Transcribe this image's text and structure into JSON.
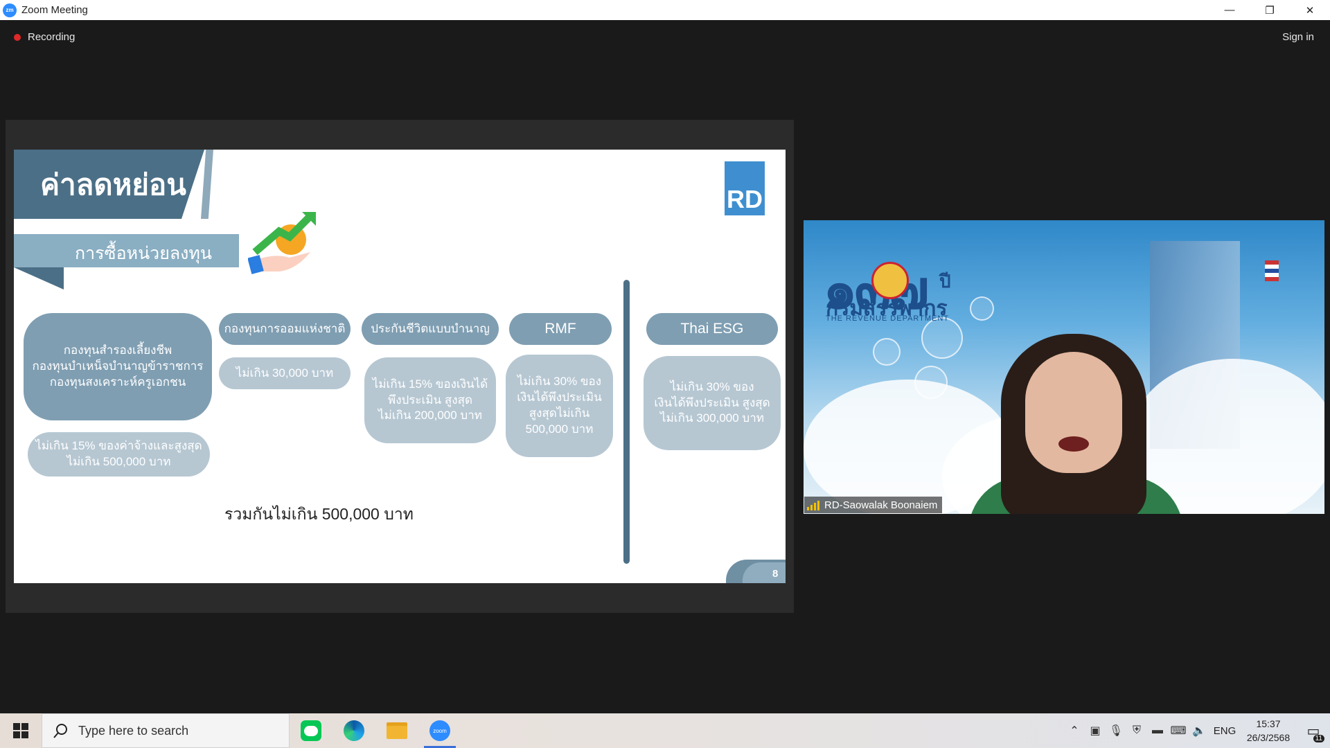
{
  "window": {
    "logo_text": "zm",
    "title": "Zoom Meeting",
    "minimize": "—",
    "restore": "❐",
    "close": "✕"
  },
  "meeting": {
    "recording_label": "Recording",
    "sign_in_label": "Sign in"
  },
  "slide": {
    "title": "ค่าลดหย่อน",
    "subtitle": "การซื้อหน่วยลงทุน",
    "logo_text": "RD",
    "col1_header": "กองทุนสำรองเลี้ยงชีพ\nกองทุนบำเหน็จบำนาญข้าราชการ\nกองทุนสงเคราะห์ครูเอกชน",
    "col1_value": "ไม่เกิน 15% ของค่าจ้างและสูงสุด\nไม่เกิน 500,000 บาท",
    "col2_header": "กองทุนการออมแห่งชาติ",
    "col2_value": "ไม่เกิน 30,000 บาท",
    "col3_header": "ประกันชีวิตแบบบำนาญ",
    "col3_value": "ไม่เกิน 15% ของเงินได้\nพึงประเมิน สูงสุด\nไม่เกิน 200,000 บาท",
    "col4_header": "RMF",
    "col4_value": "ไม่เกิน 30% ของ\nเงินได้พึงประเมิน\nสูงสุดไม่เกิน\n500,000 บาท",
    "col5_header": "Thai ESG",
    "col5_value": "ไม่เกิน 30% ของ\nเงินได้พึงประเมิน สูงสุด\nไม่เกิน 300,000 บาท",
    "total": "รวมกันไม่เกิน 500,000 บาท",
    "page_number": "8"
  },
  "video": {
    "logo_text": "๑๓๗",
    "logo_suffix": "ปี",
    "org_thai": "กรมสรรพากร",
    "org_english": "THE REVENUE DEPARTMENT",
    "participant_name": "RD-Saowalak Boonaiem"
  },
  "taskbar": {
    "search_placeholder": "Type here to search",
    "apps": [
      "line-app",
      "edge-app",
      "file-explorer-app",
      "zoom-app"
    ],
    "language": "ENG",
    "time": "15:37",
    "date": "26/3/2568",
    "notification_count": "11"
  },
  "colors": {
    "slide_dark": "#4b6f86",
    "slide_pill": "#7f9eb2",
    "slide_pill_light": "#b6c7d2",
    "recording_dot": "#e02828",
    "zoom_blue": "#2d8cff"
  }
}
